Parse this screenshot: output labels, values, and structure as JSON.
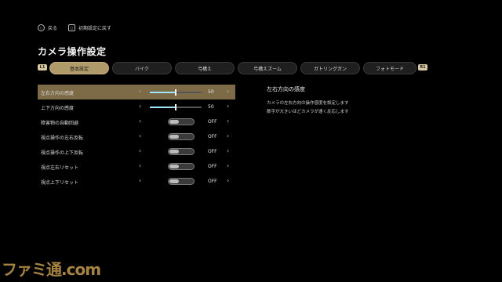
{
  "nav": {
    "back_label": "戻る",
    "back_key": "○",
    "reset_label": "初期設定に戻す",
    "reset_key": "□"
  },
  "title": "カメラ操作設定",
  "tabs": {
    "left_bumper": "L1",
    "right_bumper": "R1",
    "items": [
      "基本設定",
      "バイク",
      "弓構え",
      "弓構えズーム",
      "ガトリングガン",
      "フォトモード"
    ],
    "active_index": 0
  },
  "settings": [
    {
      "label": "左右方向の感度",
      "type": "slider",
      "value": "50",
      "level": 0.5,
      "selected": true
    },
    {
      "label": "上下方向の感度",
      "type": "slider",
      "value": "50",
      "level": 0.5
    },
    {
      "label": "障害物の自動回避",
      "type": "toggle",
      "value": "OFF"
    },
    {
      "label": "視点操作の左右反転",
      "type": "toggle",
      "value": "OFF"
    },
    {
      "label": "視点操作の上下反転",
      "type": "toggle",
      "value": "OFF"
    },
    {
      "label": "視点左右リセット",
      "type": "toggle",
      "value": "OFF"
    },
    {
      "label": "視点上下リセット",
      "type": "toggle",
      "value": "OFF"
    }
  ],
  "arrows": {
    "left": "‹",
    "right": "›"
  },
  "description": {
    "title": "左右方向の感度",
    "line1": "カメラの左右方向の操作感度を設定します",
    "line2": "数字が大きいほどカメラが速く反応します"
  },
  "watermark": "ファミ通.com",
  "colors": {
    "accent": "#b09a6a",
    "selected_row": "#7d6a46",
    "slider_fill": "#9ee6ff"
  }
}
